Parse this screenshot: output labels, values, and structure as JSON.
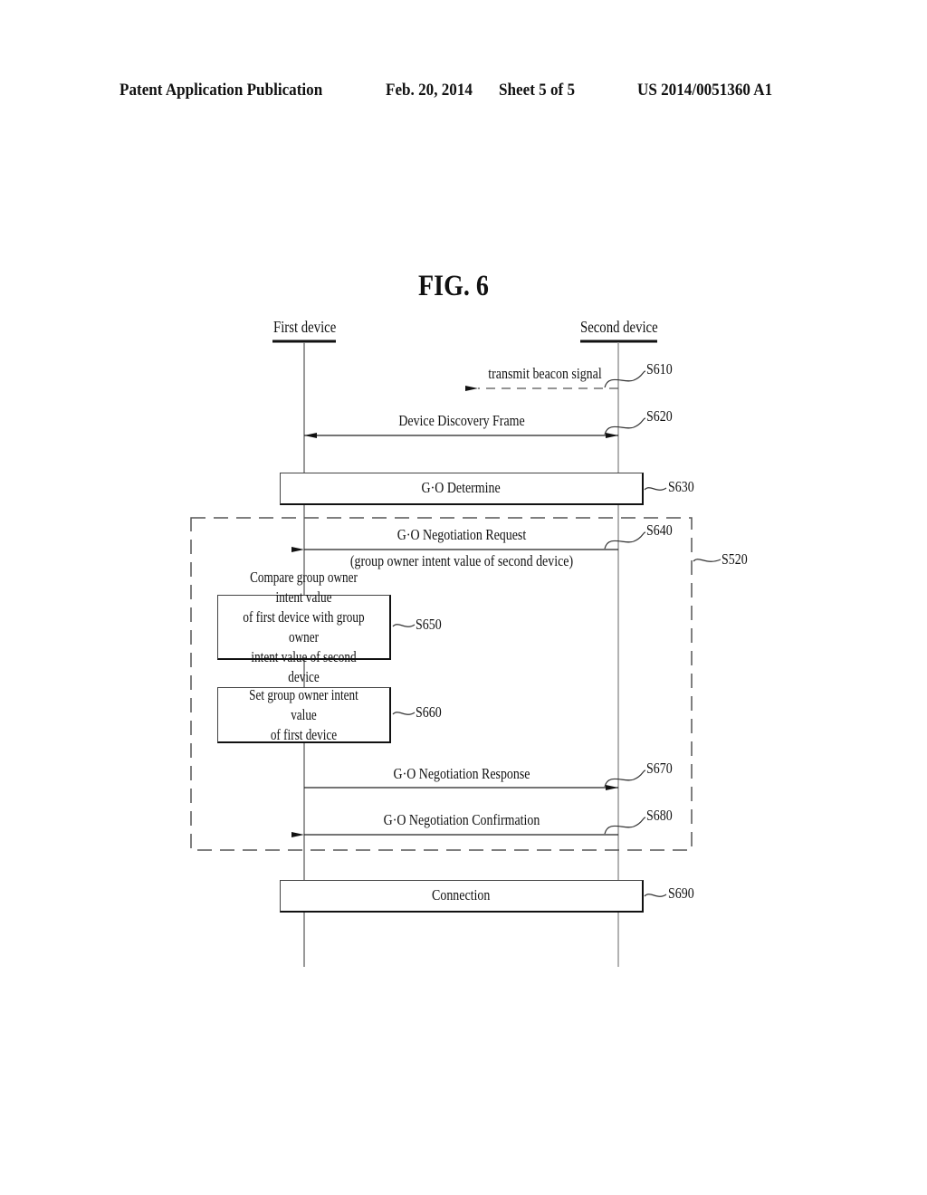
{
  "header": {
    "publication": "Patent Application Publication",
    "date": "Feb. 20, 2014",
    "sheet": "Sheet 5 of 5",
    "number": "US 2014/0051360 A1"
  },
  "figure": {
    "title": "FIG. 6",
    "lanes": [
      {
        "id": "first",
        "label": "First device"
      },
      {
        "id": "second",
        "label": "Second device"
      }
    ],
    "messages": [
      {
        "step": "S610",
        "label": "transmit beacon signal",
        "from": "second",
        "direction": "left",
        "style": "dashed",
        "partial": true
      },
      {
        "step": "S620",
        "label": "Device Discovery Frame",
        "direction": "both",
        "style": "solid"
      },
      {
        "step": "S640",
        "label": "G·O Negotiation Request",
        "sublabel": "(group owner intent value of second device)",
        "from": "second",
        "to": "first",
        "style": "solid"
      },
      {
        "step": "S670",
        "label": "G·O Negotiation Response",
        "from": "first",
        "to": "second",
        "style": "solid"
      },
      {
        "step": "S680",
        "label": "G·O Negotiation Confirmation",
        "from": "second",
        "to": "first",
        "style": "solid"
      }
    ],
    "spanning_boxes": [
      {
        "step": "S630",
        "label": "G·O Determine"
      },
      {
        "step": "S690",
        "label": "Connection"
      }
    ],
    "process_boxes": [
      {
        "step": "S650",
        "label": "Compare group owner intent value\nof first device with group owner\nintent value of second device"
      },
      {
        "step": "S660",
        "label": "Set group owner intent value\nof first device"
      }
    ],
    "group": {
      "step": "S520",
      "style": "dashed"
    }
  }
}
